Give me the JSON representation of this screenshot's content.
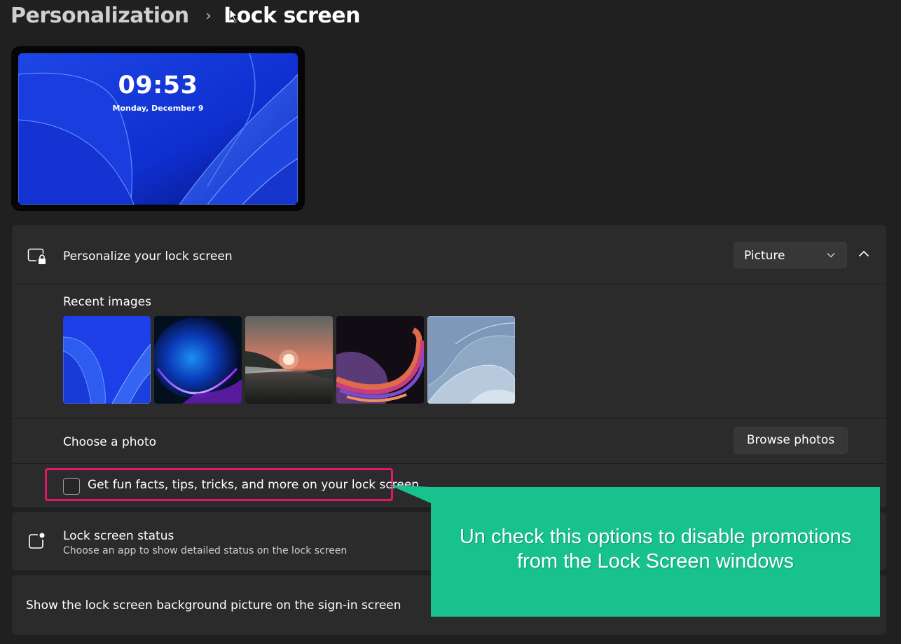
{
  "breadcrumb": {
    "parent": "Personalization",
    "separator": "›",
    "current": "Lock screen"
  },
  "preview": {
    "time": "09:53",
    "date": "Monday, December 9"
  },
  "personalize": {
    "icon": "lock-screen-icon",
    "label": "Personalize your lock screen",
    "dropdown_value": "Picture",
    "expanded": true,
    "recent_images_label": "Recent images",
    "recent_images": [
      {
        "name": "blue-bloom-wallpaper"
      },
      {
        "name": "glow-orb-wallpaper"
      },
      {
        "name": "sunset-lake-wallpaper"
      },
      {
        "name": "ribbon-wave-wallpaper"
      },
      {
        "name": "light-bloom-wallpaper"
      }
    ],
    "choose_photo_label": "Choose a photo",
    "browse_button": "Browse photos",
    "fun_facts_label": "Get fun facts, tips, tricks, and more on your lock screen",
    "fun_facts_checked": false
  },
  "status": {
    "icon": "app-badge-icon",
    "title": "Lock screen status",
    "subtitle": "Choose an app to show detailed status on the lock screen"
  },
  "signin": {
    "label": "Show the lock screen background picture on the sign-in screen"
  },
  "annotation": {
    "text_line1": "Un check this options to disable promotions",
    "text_line2": "from the Lock Screen windows",
    "highlight_color": "#e3176a",
    "callout_color": "#18c28d"
  }
}
